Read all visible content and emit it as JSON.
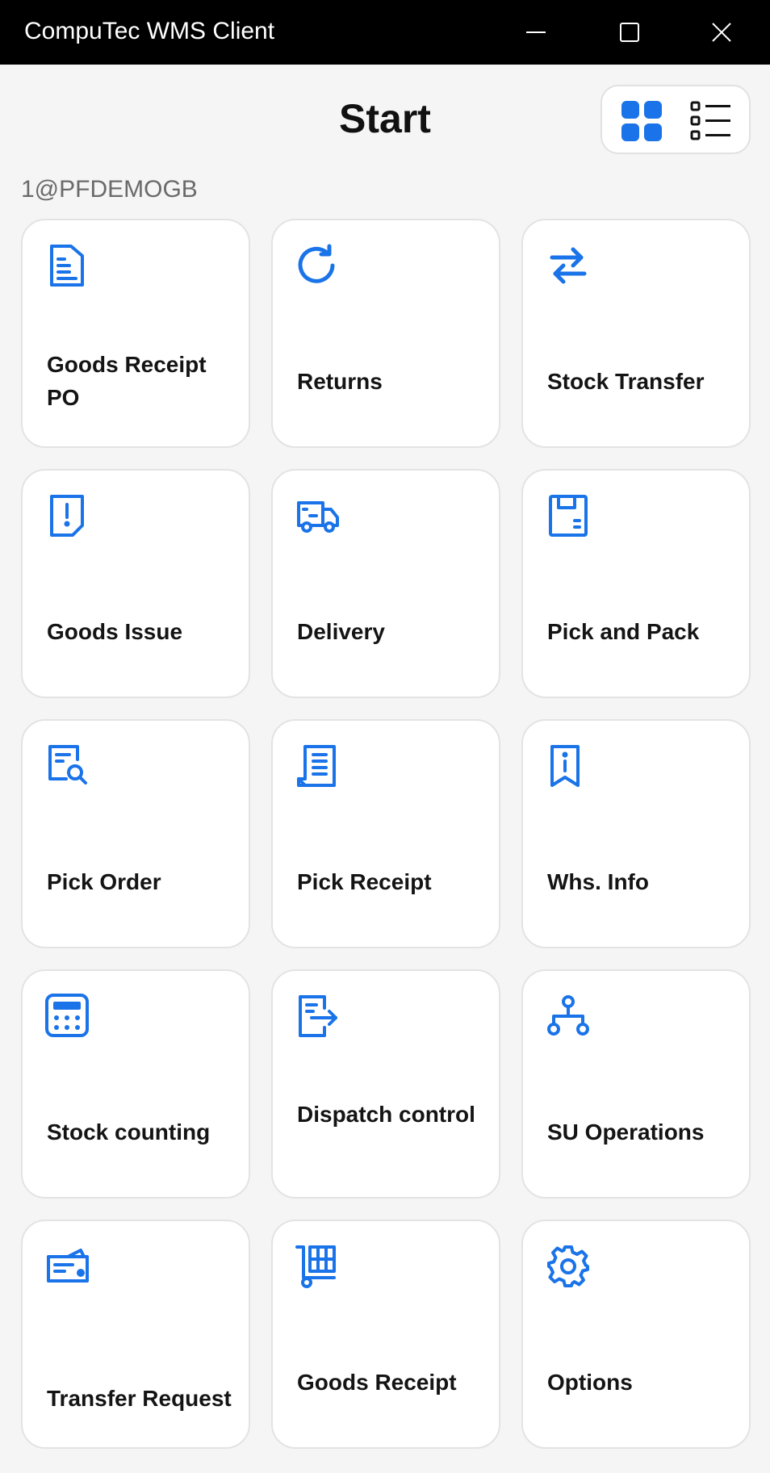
{
  "window": {
    "title": "CompuTec WMS Client",
    "controls": [
      "minimize",
      "maximize",
      "close"
    ]
  },
  "page": {
    "title": "Start"
  },
  "view_toggle": {
    "options": [
      {
        "name": "grid-view",
        "icon": "grid-icon",
        "active": true
      },
      {
        "name": "list-view",
        "icon": "list-icon",
        "active": false
      }
    ]
  },
  "user": {
    "label": "1@PFDEMOGB"
  },
  "accent_color": "#1a73e8",
  "tiles": [
    {
      "label": "Goods Receipt PO",
      "icon": "document-list-icon"
    },
    {
      "label": "Returns",
      "icon": "refresh-icon"
    },
    {
      "label": "Stock Transfer",
      "icon": "transfer-arrows-icon"
    },
    {
      "label": "Goods Issue",
      "icon": "document-alert-icon"
    },
    {
      "label": "Delivery",
      "icon": "delivery-truck-icon"
    },
    {
      "label": "Pick and Pack",
      "icon": "floppy-disk-icon"
    },
    {
      "label": "Pick Order",
      "icon": "document-search-icon"
    },
    {
      "label": "Pick Receipt",
      "icon": "receipt-icon"
    },
    {
      "label": "Whs. Info",
      "icon": "info-bookmark-icon"
    },
    {
      "label": "Stock counting",
      "icon": "calculator-icon"
    },
    {
      "label": "Dispatch control",
      "icon": "document-export-icon"
    },
    {
      "label": "SU Operations",
      "icon": "hierarchy-icon"
    },
    {
      "label": "Transfer Request",
      "icon": "ticket-card-icon"
    },
    {
      "label": "Goods Receipt",
      "icon": "pallet-cart-icon"
    },
    {
      "label": "Options",
      "icon": "gear-icon"
    }
  ]
}
